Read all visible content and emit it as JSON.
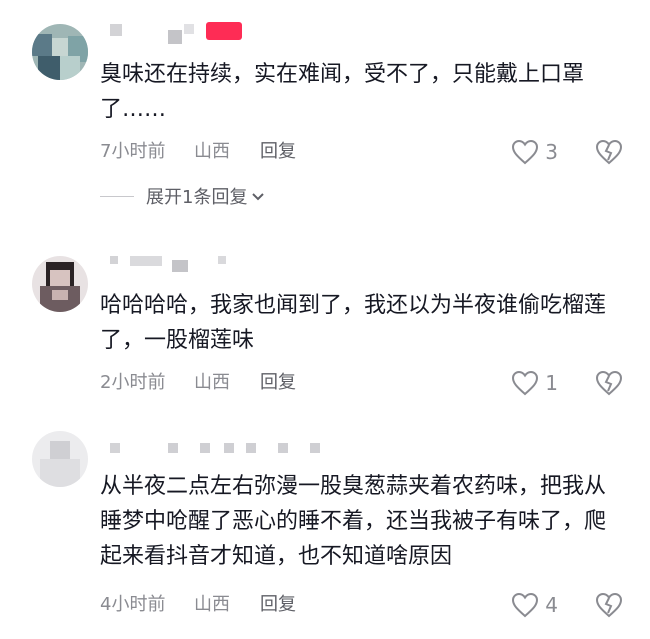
{
  "comments": [
    {
      "badge": "",
      "text": "臭味还在持续，实在难闻，受不了，只能戴上口罩了……",
      "time": "7小时前",
      "location": "山西",
      "reply_label": "回复",
      "likes": "3",
      "expand_label": "展开1条回复"
    },
    {
      "text": "哈哈哈哈，我家也闻到了，我还以为半夜谁偷吃榴莲了，一股榴莲味",
      "time": "2小时前",
      "location": "山西",
      "reply_label": "回复",
      "likes": "1"
    },
    {
      "text": "从半夜二点左右弥漫一股臭葱蒜夹着农药味，把我从睡梦中呛醒了恶心的睡不着，还当我被子有味了，爬起来看抖音才知道，也不知道啥原因",
      "time": "4小时前",
      "location": "山西",
      "reply_label": "回复",
      "likes": "4"
    }
  ],
  "colors": {
    "text": "#161823",
    "secondary": "#8a8b91",
    "badge": "#fe2c55"
  },
  "icons": [
    "heart-outline-icon",
    "broken-heart-icon",
    "chevron-down-icon"
  ]
}
